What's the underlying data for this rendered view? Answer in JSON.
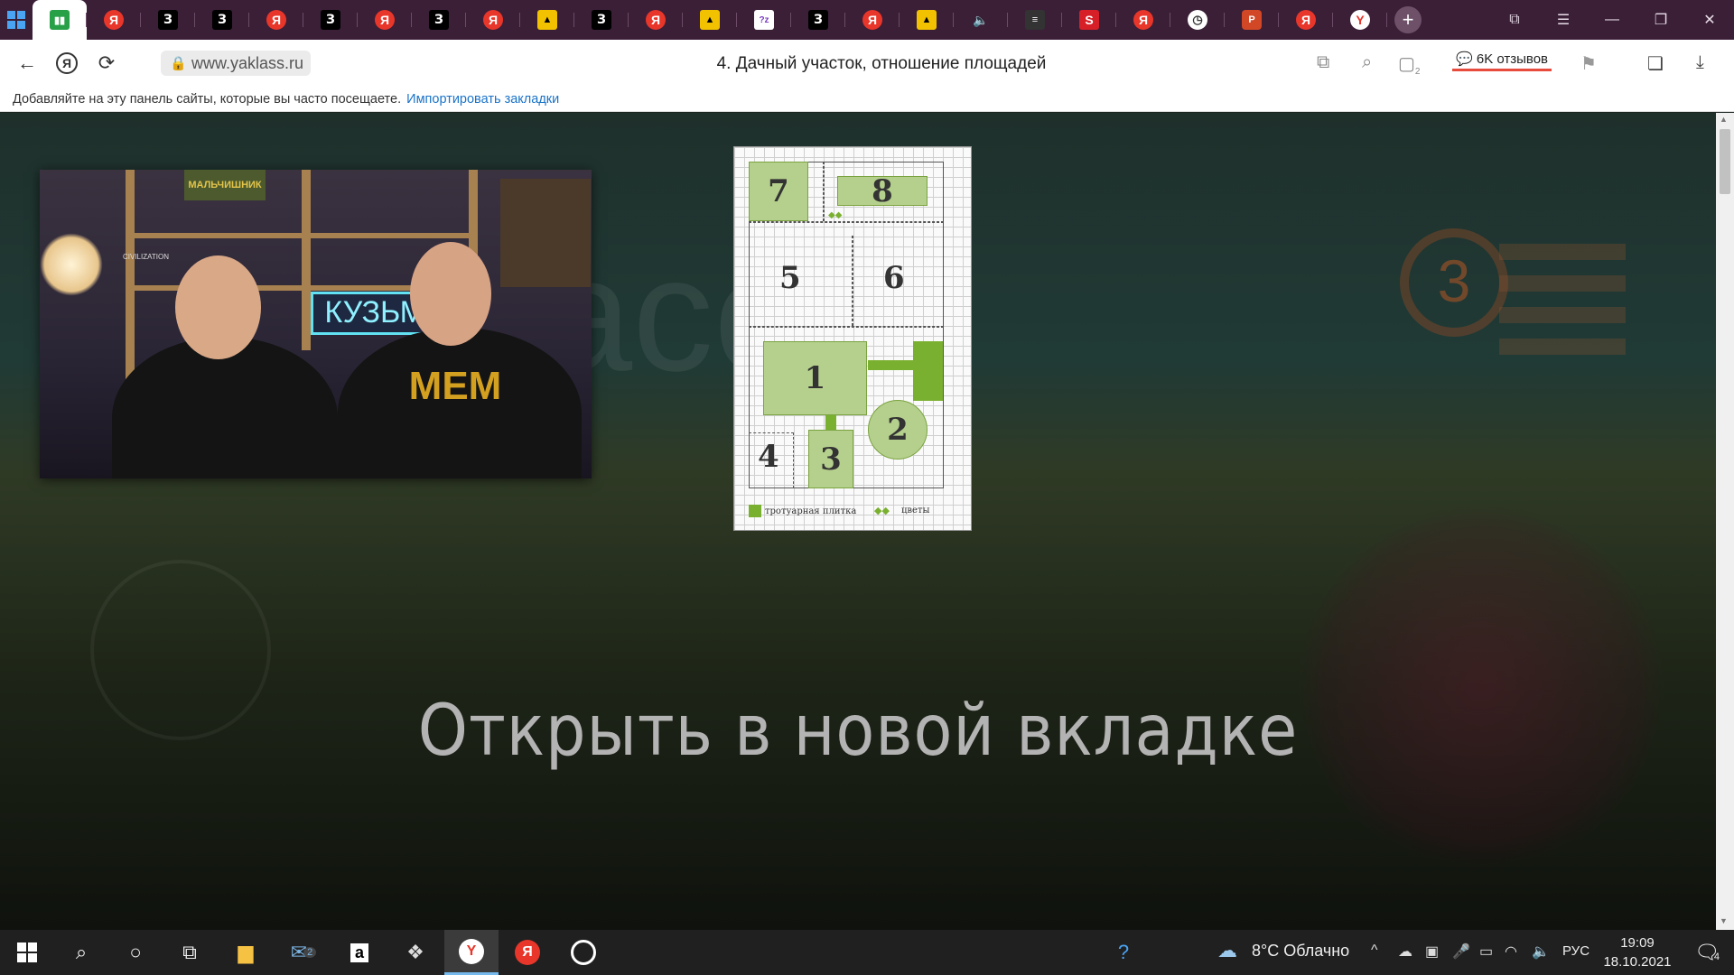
{
  "browser": {
    "tabs": [
      {
        "icon": "book-icon",
        "glyph": "▮▮",
        "cls": "book",
        "active": true
      },
      {
        "icon": "yandex-icon",
        "glyph": "Я",
        "cls": "ya"
      },
      {
        "icon": "z-icon",
        "glyph": "З",
        "cls": "z"
      },
      {
        "icon": "z-icon",
        "glyph": "З",
        "cls": "z"
      },
      {
        "icon": "yandex-icon",
        "glyph": "Я",
        "cls": "ya"
      },
      {
        "icon": "z-icon",
        "glyph": "З",
        "cls": "z"
      },
      {
        "icon": "yandex-icon",
        "glyph": "Я",
        "cls": "ya"
      },
      {
        "icon": "z-icon",
        "glyph": "З",
        "cls": "z"
      },
      {
        "icon": "yandex-icon",
        "glyph": "Я",
        "cls": "ya"
      },
      {
        "icon": "images-icon",
        "glyph": "▲",
        "cls": "img"
      },
      {
        "icon": "z-icon",
        "glyph": "З",
        "cls": "z"
      },
      {
        "icon": "yandex-icon",
        "glyph": "Я",
        "cls": "ya"
      },
      {
        "icon": "images-icon",
        "glyph": "▲",
        "cls": "img"
      },
      {
        "icon": "quiz-icon",
        "glyph": "?z",
        "cls": "qz"
      },
      {
        "icon": "z-icon",
        "glyph": "З",
        "cls": "z"
      },
      {
        "icon": "yandex-icon",
        "glyph": "Я",
        "cls": "ya"
      },
      {
        "icon": "images-icon",
        "glyph": "▲",
        "cls": "img"
      },
      {
        "icon": "speaker-icon",
        "glyph": "🔈",
        "cls": "spk"
      },
      {
        "icon": "sticker-icon",
        "glyph": "≡",
        "cls": "stk"
      },
      {
        "icon": "s-icon",
        "glyph": "S",
        "cls": "s"
      },
      {
        "icon": "yandex-icon",
        "glyph": "Я",
        "cls": "ya"
      },
      {
        "icon": "clock-icon",
        "glyph": "◷",
        "cls": "clock"
      },
      {
        "icon": "powerpoint-icon",
        "glyph": "P",
        "cls": "ppt"
      },
      {
        "icon": "yandex-icon",
        "glyph": "Я",
        "cls": "ya"
      },
      {
        "icon": "yandex-browser-icon",
        "glyph": "Y",
        "cls": "yb"
      }
    ],
    "new_tab_label": "+",
    "url": "www.yaklass.ru",
    "page_title": "4. Дачный участок, отношение площадей",
    "reviews": "6K отзывов",
    "bookmarks_hint": "Добавляйте на эту панель сайты, которые вы часто посещаете.",
    "import_bookmarks": "Импортировать закладки",
    "extensions_badge": "2"
  },
  "content": {
    "ghost_word": "асс",
    "ghost_badge_number": "3",
    "video_neon_text": "КУЗЬМА",
    "video_poster_text": "МАЛЬЧИШНИК",
    "video_shelf_label": "CIVILIZATION",
    "video_shirt_text": "MEM",
    "open_in_new_tab": "Открыть в новой вкладке"
  },
  "diagram": {
    "plots": [
      "7",
      "8",
      "5",
      "6",
      "1",
      "2",
      "4",
      "3"
    ],
    "legend_tile": "тротуарная плитка",
    "legend_flowers": "цветы"
  },
  "taskbar": {
    "mail_badge": "2",
    "weather": "8°C Облачно",
    "language": "РУС",
    "time": "19:09",
    "date": "18.10.2021",
    "notifications_badge": "4"
  }
}
